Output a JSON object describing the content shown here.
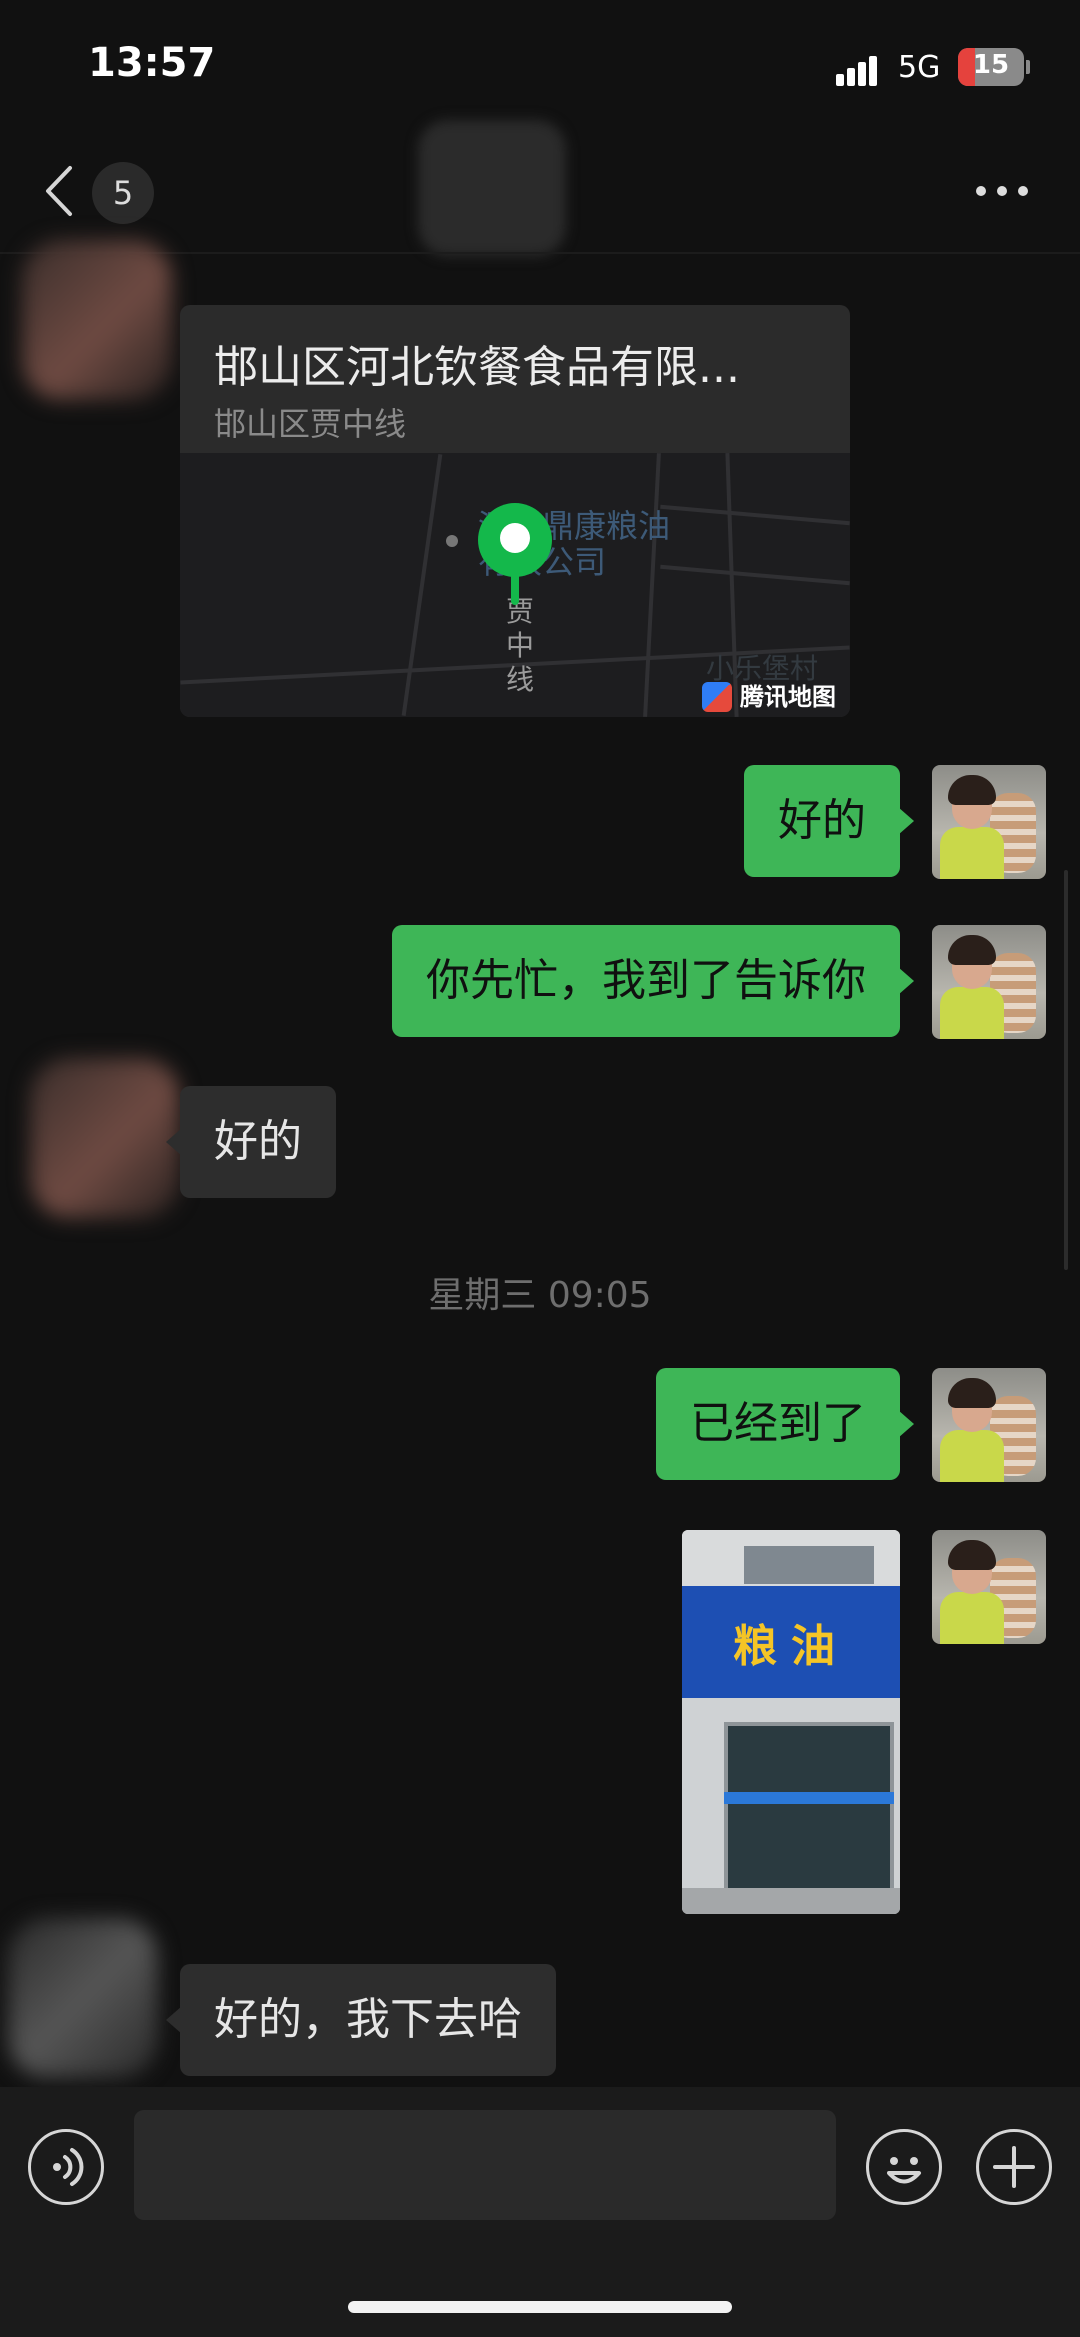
{
  "status_bar": {
    "time": "13:57",
    "network": "5G",
    "battery": "15"
  },
  "nav": {
    "unread_count": "5"
  },
  "messages": {
    "location": {
      "title": "邯山区河北钦餐食品有限...",
      "address": "邯山区贾中线",
      "map_label_1": "河北鼎康粮油",
      "map_label_2": "有限公司",
      "road_label": "贾中线",
      "village_label": "小乐堡村",
      "brand": "腾讯地图"
    },
    "m1": "好的",
    "m2": "你先忙，我到了告诉你",
    "m3": "好的",
    "timestamp": "星期三 09:05",
    "m4": "已经到了",
    "photo_sign": "粮油",
    "m5": "好的，我下去哈"
  },
  "colors": {
    "self_bubble": "#3eb657",
    "other_bubble": "#2d2d2d",
    "background": "#111111",
    "map_pin": "#14b84b"
  },
  "icons": {
    "back": "chevron-left-icon",
    "more": "more-dots-icon",
    "voice": "voice-icon",
    "emoji": "emoji-icon",
    "plus": "plus-icon"
  }
}
